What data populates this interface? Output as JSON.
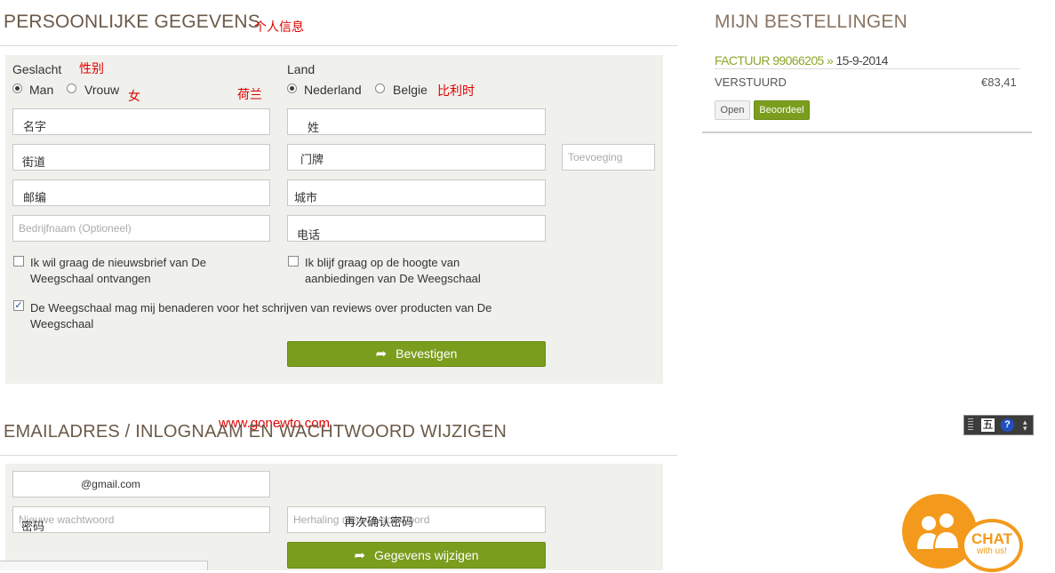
{
  "personal": {
    "title": "PERSOONLIJKE GEGEVENS",
    "title_note": "个人信息",
    "gender_label": "Geslacht",
    "gender_note": "性别",
    "gender_options": [
      "Man",
      "Vrouw"
    ],
    "gender_selected": "Man",
    "female_note": "女",
    "netherlands_note": "荷兰",
    "country_label": "Land",
    "country_options": [
      "Nederland",
      "Belgie"
    ],
    "country_selected": "Nederland",
    "belgium_note": "比利时",
    "firstname_note": "名字",
    "lastname_note": "姓",
    "street_note": "街道",
    "housenumber_note": "门牌",
    "addition_placeholder": "Toevoeging",
    "postcode_note": "邮编",
    "city_note": "城市",
    "company_placeholder": "Bedrijfnaam (Optioneel)",
    "phone_note": "电话",
    "newsletter_label": "Ik wil graag de nieuwsbrief van De Weegschaal ontvangen",
    "offers_label": "Ik blijf graag op de hoogte van aanbiedingen van De Weegschaal",
    "reviews_label": "De Weegschaal mag mij benaderen voor het schrijven van reviews over producten van De Weegschaal",
    "confirm_button": "Bevestigen"
  },
  "email_section": {
    "title": "EMAILADRES / INLOGNAAM EN WACHTWOORD WIJZIGEN",
    "watermark": "www.gonewto.com",
    "email_value": "@gmail.com",
    "new_password_placeholder": "Nieuwe wachtwoord",
    "password_note": "密码",
    "repeat_password_placeholder": "Herhaling nieuw wachtwoord",
    "repeat_note": "再次确认密码",
    "change_button": "Gegevens wijzigen"
  },
  "orders": {
    "title": "MIJN BESTELLINGEN",
    "invoice_label": "FACTUUR 99066205",
    "invoice_sep": " » ",
    "invoice_date": "15-9-2014",
    "status": "VERSTUURD",
    "amount": "€83,41",
    "open_button": "Open",
    "review_button": "Beoordeel"
  },
  "chat": {
    "line1": "CHAT",
    "line2": "with us!"
  },
  "colors": {
    "accent_green": "#7a9d1e",
    "heading_brown": "#6b5a48",
    "chat_orange": "#f39a1c",
    "annotation_red": "#e00000"
  }
}
